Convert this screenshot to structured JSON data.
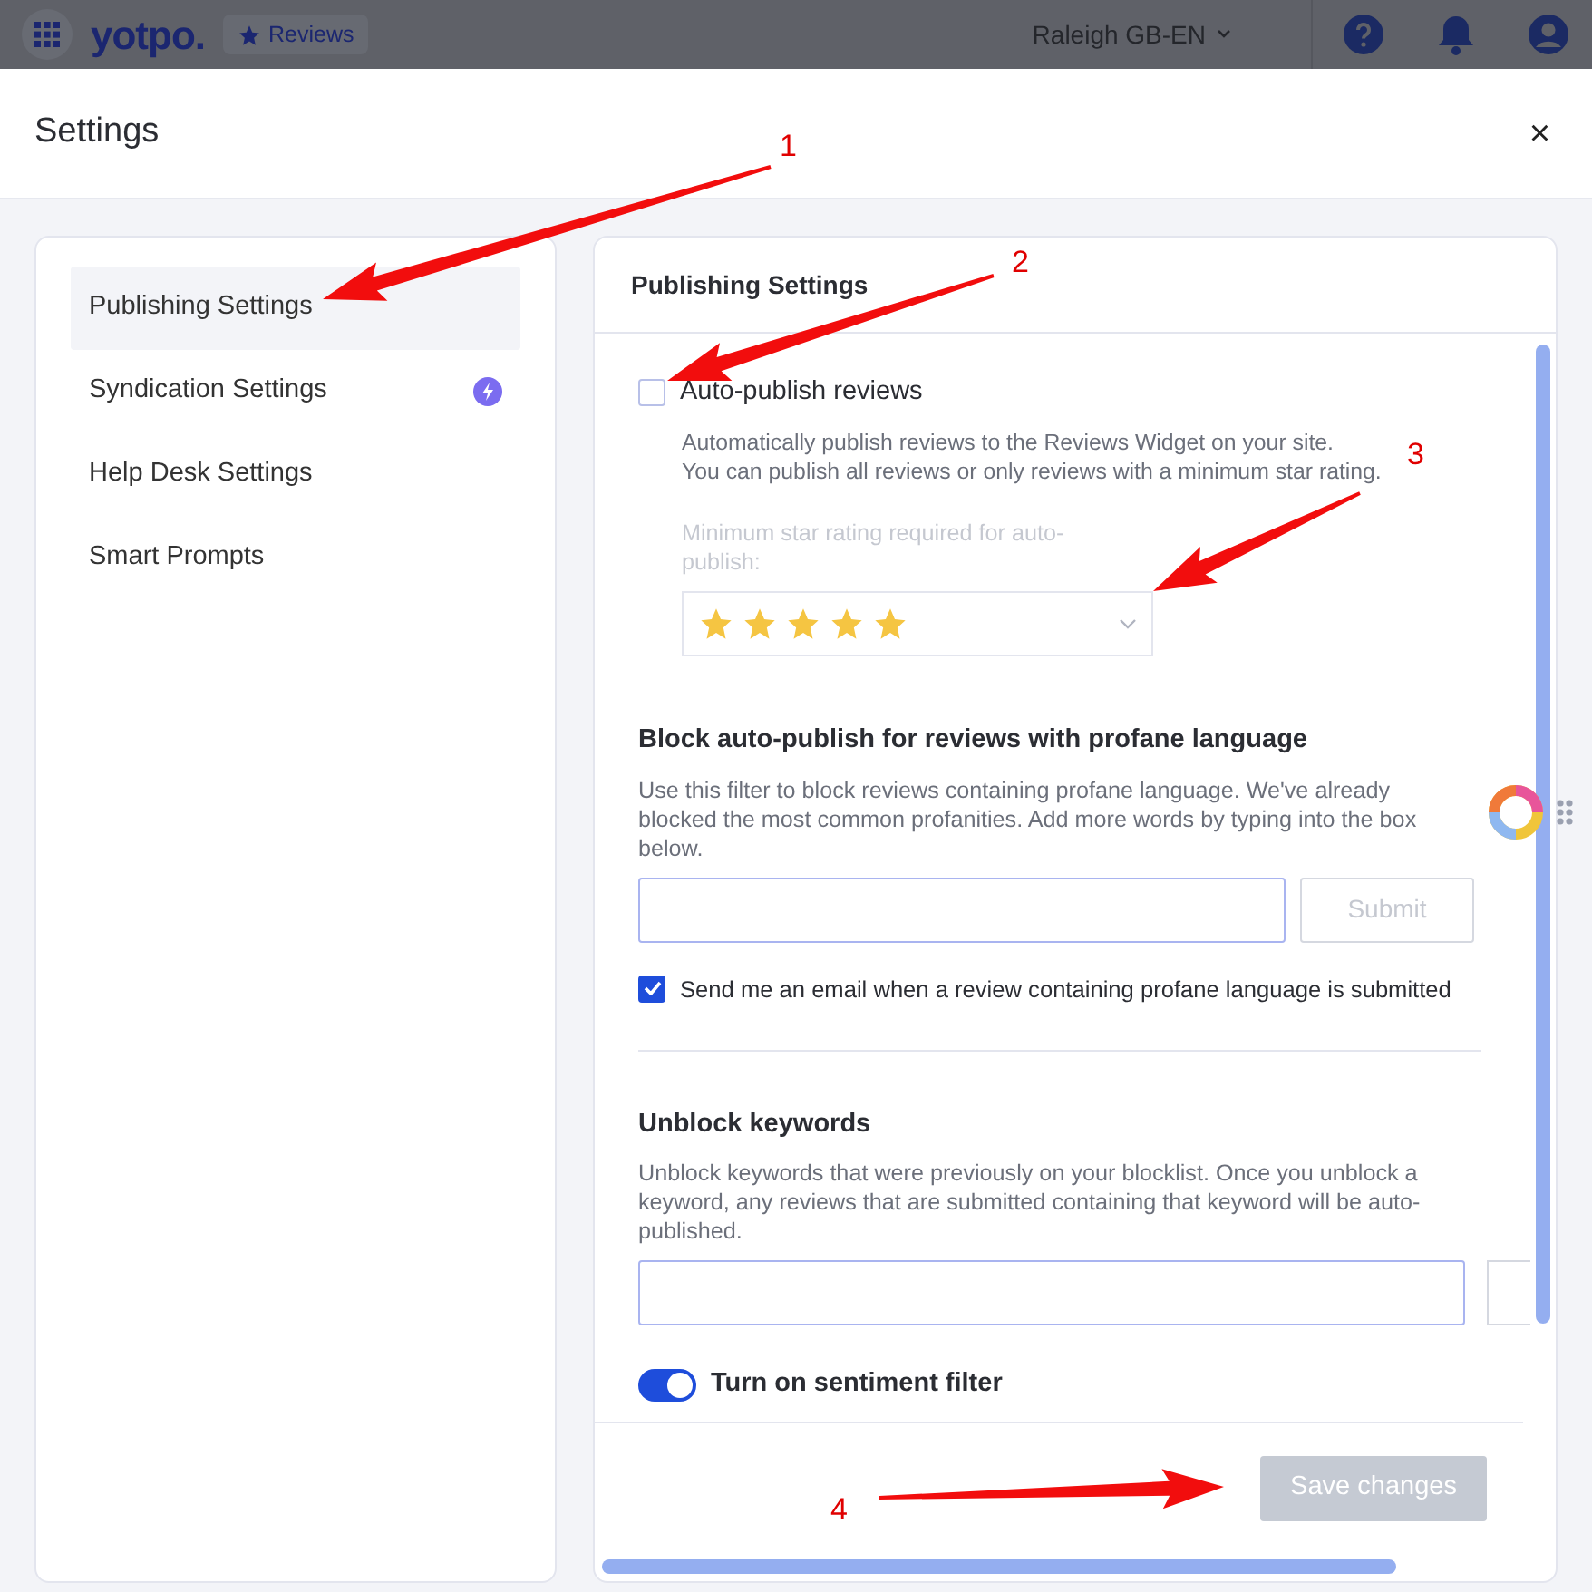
{
  "top_bar": {
    "logo": "yotpo.",
    "product": "Reviews",
    "store": "Raleigh GB-EN"
  },
  "modal": {
    "title": "Settings",
    "close": "×"
  },
  "sidebar": {
    "items": [
      {
        "label": "Publishing Settings",
        "selected": true,
        "upgrade": false
      },
      {
        "label": "Syndication Settings",
        "selected": false,
        "upgrade": true
      },
      {
        "label": "Help Desk Settings",
        "selected": false,
        "upgrade": false
      },
      {
        "label": "Smart Prompts",
        "selected": false,
        "upgrade": false
      }
    ]
  },
  "panel": {
    "title": "Publishing Settings",
    "auto_publish": {
      "label": "Auto-publish reviews",
      "checked": false,
      "description": [
        "Automatically publish reviews to the Reviews Widget on your site.",
        "You can publish all reviews or only reviews with a minimum star rating."
      ],
      "rating_label": "Minimum star rating required for auto-publish:",
      "stars": 5,
      "disabled": true
    },
    "profanity": {
      "heading": "Block auto-publish for reviews with profane language",
      "description": "Use this filter to block reviews containing profane language. We've already blocked the most common profanities. Add more words by typing into the box below.",
      "submit": "Submit",
      "submit_disabled": true,
      "email": {
        "label": "Send me an email when a review containing profane language is submitted",
        "checked": true
      }
    },
    "unblock": {
      "heading": "Unblock keywords",
      "description": "Unblock keywords that were previously on your blocklist. Once you unblock a keyword, any reviews that are submitted containing that keyword will be auto-published."
    },
    "sentiment": {
      "label": "Turn on sentiment filter",
      "on": true
    },
    "save": {
      "label": "Save changes",
      "disabled": true
    }
  },
  "annotations": [
    "1",
    "2",
    "3",
    "4"
  ]
}
